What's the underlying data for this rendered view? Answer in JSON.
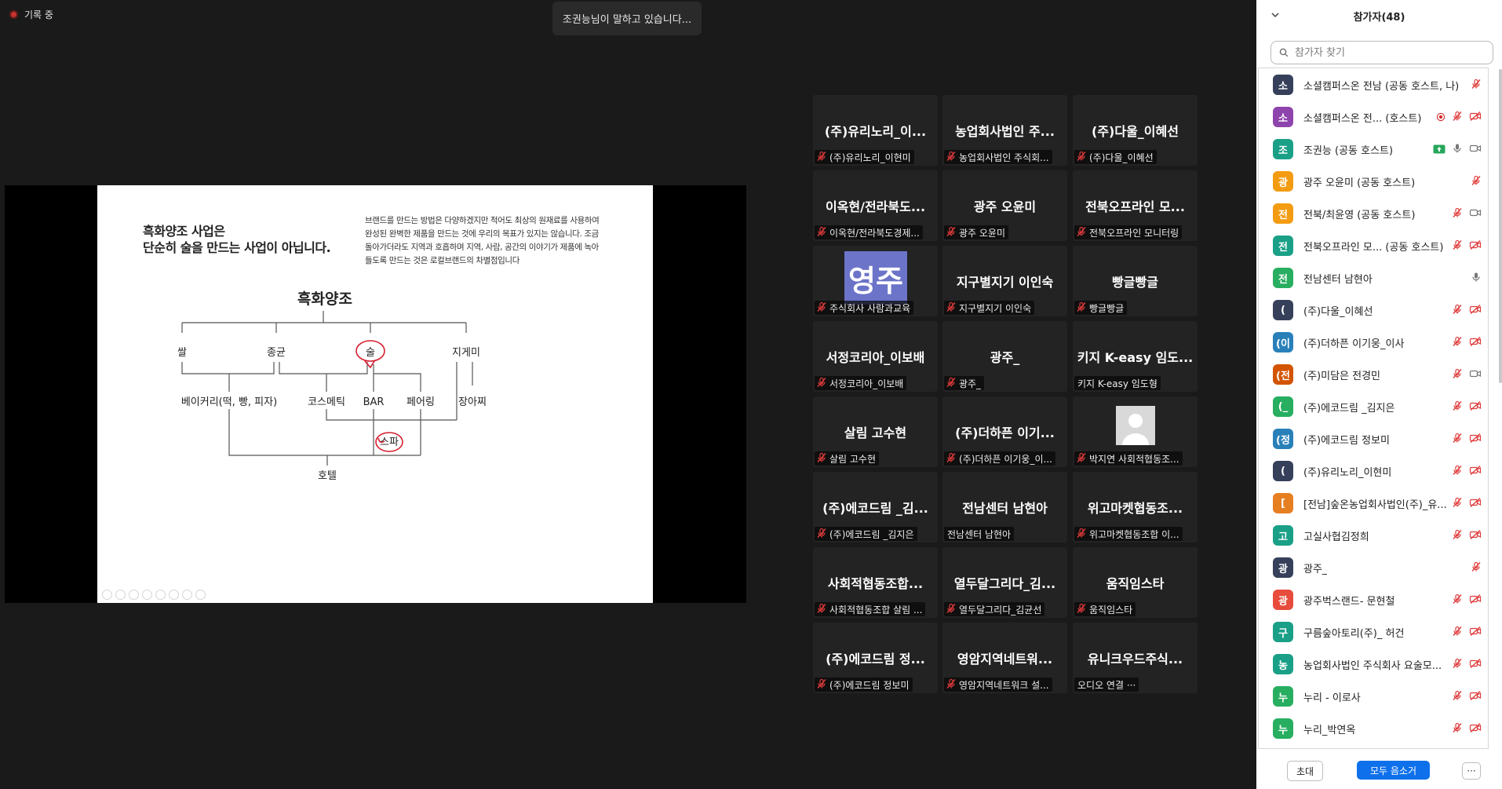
{
  "recording": {
    "label": "기록 중"
  },
  "speaking": {
    "text": "조권능님이 말하고 있습니다..."
  },
  "slide": {
    "heading_line1": "흑화양조 사업은",
    "heading_line2": "단순히 술을 만드는 사업이 아닙니다.",
    "body_lines": [
      "브랜드를 만드는 방법은 다양하겠지만 적어도 최상의 원재료를 사용하여",
      "완성된 완벽한 제품을 만드는 것에 우리의 목표가 있지는 않습니다. 조금",
      "돌아가더라도 지역과 호흡하며 지역, 사람, 공간의 이야기가 제품에 녹아",
      "들도록 만드는 것은 로컬브랜드의 차별점입니다"
    ],
    "tree": {
      "root": "흑화양조",
      "level1": [
        "쌀",
        "종균",
        "술",
        "지게미"
      ],
      "level2": [
        "베이커리(떡, 빵, 피자)",
        "코스메틱",
        "BAR",
        "페어링",
        "장아찌"
      ],
      "level3": "스파",
      "level4": "호텔"
    }
  },
  "grid": {
    "tiles": [
      {
        "big": "(주)유리노리_이...",
        "cap": "(주)유리노리_이현미",
        "muted": true
      },
      {
        "big": "농업회사법인 주...",
        "cap": "농업회사법인 주식회...",
        "muted": true
      },
      {
        "big": "(주)다울_이혜선",
        "cap": "(주)다울_이혜선",
        "muted": true
      },
      {
        "big": "이옥현/전라북도...",
        "cap": "이옥현/전라북도경제...",
        "muted": true
      },
      {
        "big": "광주 오윤미",
        "cap": "광주 오윤미",
        "muted": true
      },
      {
        "big": "전북오프라인 모...",
        "cap": "전북오프라인 모니터링",
        "muted": true
      },
      {
        "big": "",
        "pic": "영주",
        "cap": "주식회사 사람과교육",
        "muted": true
      },
      {
        "big": "지구별지기 이인숙",
        "cap": "지구별지기 이인숙",
        "muted": true
      },
      {
        "big": "빵글빵글",
        "cap": "빵글빵글",
        "muted": true
      },
      {
        "big": "서정코리아_이보배",
        "cap": "서정코리아_이보배",
        "muted": true
      },
      {
        "big": "광주_",
        "cap": "광주_",
        "muted": true
      },
      {
        "big": "키지 K-easy 임도...",
        "cap": "키지 K-easy 임도형",
        "muted": false
      },
      {
        "big": "살림 고수현",
        "cap": "살림 고수현",
        "muted": true
      },
      {
        "big": "(주)더하픈 이기...",
        "cap": "(주)더하픈 이기웅_이...",
        "muted": true
      },
      {
        "big": "",
        "person": true,
        "cap": "박지연 사회적협동조...",
        "muted": true
      },
      {
        "big": "(주)에코드림 _김...",
        "cap": "(주)에코드림 _김지은",
        "muted": true
      },
      {
        "big": "전남센터 남현아",
        "cap": "전남센터 남현아",
        "muted": false
      },
      {
        "big": "위고마켓협동조...",
        "cap": "위고마켓협동조합 이...",
        "muted": true
      },
      {
        "big": "사회적협동조합...",
        "cap": "사회적협동조합 살림 ...",
        "muted": true
      },
      {
        "big": "열두달그리다_김...",
        "cap": "열두달그리다_김균선",
        "muted": true
      },
      {
        "big": "움직임스타",
        "cap": "움직임스타",
        "muted": true
      },
      {
        "big": "(주)에코드림 정...",
        "cap": "(주)에코드림 정보미",
        "muted": true
      },
      {
        "big": "영암지역네트워...",
        "cap": "영암지역네트워크 설...",
        "muted": true
      },
      {
        "big": "유니크우드주식...",
        "cap": "오디오 연결 ···",
        "muted": false
      }
    ]
  },
  "panel": {
    "title": "참가자(48)",
    "search_placeholder": "참가자 찾기",
    "participants": [
      {
        "initial": "소",
        "color": "#36405a",
        "name": "소셜캠퍼스온 전남 (공동 호스트, 나)",
        "icons": [
          "mic-muted"
        ]
      },
      {
        "initial": "소",
        "color": "#8e44ad",
        "name": "소셜캠퍼스온 전...   (호스트)",
        "icons": [
          "rec",
          "mic-muted",
          "video-off"
        ]
      },
      {
        "initial": "조",
        "color": "#1aa087",
        "name": "조권능 (공동 호스트)",
        "icons": [
          "share",
          "mic",
          "video"
        ]
      },
      {
        "initial": "광",
        "color": "#f39c12",
        "name": "광주 오윤미 (공동 호스트)",
        "icons": [
          "mic-muted"
        ]
      },
      {
        "initial": "전",
        "color": "#f39c12",
        "name": "전북/최윤영 (공동 호스트)",
        "icons": [
          "mic-muted",
          "video"
        ]
      },
      {
        "initial": "전",
        "color": "#1aa087",
        "name": "전북오프라인 모...  (공동 호스트)",
        "icons": [
          "mic-muted",
          "video-off"
        ]
      },
      {
        "initial": "전",
        "color": "#27ae60",
        "name": "전남센터 남현아",
        "icons": [
          "mic"
        ]
      },
      {
        "initial": "(",
        "color": "#36405a",
        "name": "(주)다울_이혜선",
        "icons": [
          "mic-muted",
          "video-off"
        ]
      },
      {
        "initial": "(이",
        "color": "#2980b9",
        "name": "(주)더하픈 이기웅_이사",
        "icons": [
          "mic-muted",
          "video-off"
        ]
      },
      {
        "initial": "(전",
        "color": "#d35400",
        "name": "(주)미담은 전경민",
        "icons": [
          "mic-muted",
          "video"
        ]
      },
      {
        "initial": "(_",
        "color": "#27ae60",
        "name": "(주)에코드림 _김지은",
        "icons": [
          "mic-muted",
          "video-off"
        ]
      },
      {
        "initial": "(정",
        "color": "#2980b9",
        "name": "(주)에코드림 정보미",
        "icons": [
          "mic-muted",
          "video-off"
        ]
      },
      {
        "initial": "(",
        "color": "#36405a",
        "name": "(주)유리노리_이현미",
        "icons": [
          "mic-muted",
          "video-off"
        ]
      },
      {
        "initial": "[",
        "color": "#e67e22",
        "name": "[전남]숲온농업회사법인(주)_유...",
        "icons": [
          "mic-muted",
          "video-off"
        ]
      },
      {
        "initial": "고",
        "color": "#1aa087",
        "name": "고실사협김정희",
        "icons": [
          "mic-muted",
          "video-off"
        ]
      },
      {
        "initial": "광",
        "color": "#36405a",
        "name": "광주_",
        "icons": [
          "mic-muted"
        ]
      },
      {
        "initial": "광",
        "color": "#e74c3c",
        "name": "광주벅스랜드- 문현철",
        "icons": [
          "mic-muted",
          "video-off"
        ]
      },
      {
        "initial": "구",
        "color": "#1aa087",
        "name": "구름숲아토리(주)_ 허건",
        "icons": [
          "mic-muted",
          "video-off"
        ]
      },
      {
        "initial": "농",
        "color": "#1aa087",
        "name": "농업회사법인 주식회사 요술모...",
        "icons": [
          "mic-muted",
          "video-off"
        ]
      },
      {
        "initial": "누",
        "color": "#27ae60",
        "name": "누리 - 이로사",
        "icons": [
          "mic-muted",
          "video-off"
        ]
      },
      {
        "initial": "누",
        "color": "#27ae60",
        "name": "누리_박연옥",
        "icons": [
          "mic-muted",
          "video-off"
        ]
      }
    ],
    "invite_label": "초대",
    "mute_all_label": "모두 음소거",
    "more_label": "···"
  }
}
